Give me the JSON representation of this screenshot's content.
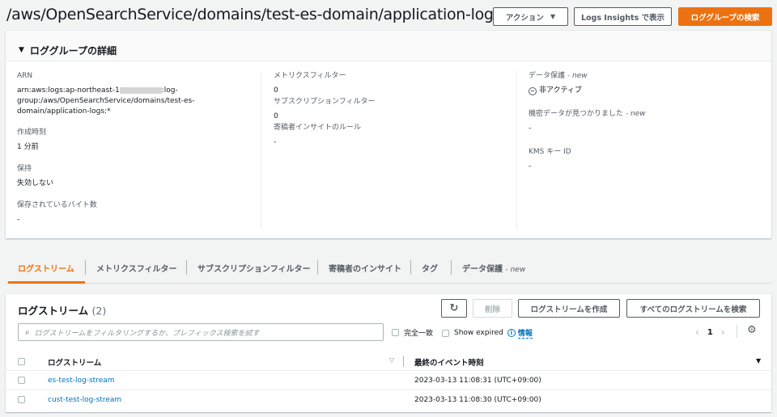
{
  "header": {
    "title": "/aws/OpenSearchService/domains/test-es-domain/application-logs",
    "actions_label": "アクション",
    "logs_insights_label": "Logs Insights で表示",
    "search_group_label": "ロググループの検索"
  },
  "details": {
    "heading": "ロググループの詳細",
    "arn_label": "ARN",
    "arn_value_prefix": "arn:aws:logs:ap-northeast-1",
    "arn_value_suffix": ":log-",
    "arn_value_line2": "group:/aws/OpenSearchService/domains/test-es-",
    "arn_value_line3": "domain/application-logs:*",
    "created_label": "作成時刻",
    "created_value": "1 分前",
    "retention_label": "保持",
    "retention_value": "失効しない",
    "stored_bytes_label": "保存されているバイト数",
    "stored_bytes_value": "-",
    "metric_filters_label": "メトリクスフィルター",
    "metric_filters_value": "0",
    "subscription_filters_label": "サブスクリプションフィルター",
    "subscription_filters_value": "0",
    "contributor_label": "寄稿者インサイトのルール",
    "contributor_value": "-",
    "data_protection_label": "データ保護",
    "data_protection_value": "非アクティブ",
    "sensitive_label": "機密データが見つかりました",
    "sensitive_value": "-",
    "kms_label": "KMS キー ID",
    "kms_value": "-",
    "new_tag": "- new"
  },
  "tabs": [
    {
      "label": "ログストリーム"
    },
    {
      "label": "メトリクスフィルター"
    },
    {
      "label": "サブスクリプションフィルター"
    },
    {
      "label": "寄稿者のインサイト"
    },
    {
      "label": "タグ"
    },
    {
      "label": "データ保護"
    }
  ],
  "streams": {
    "title": "ログストリーム",
    "count": "(2)",
    "delete_label": "削除",
    "create_label": "ログストリームを作成",
    "search_all_label": "すべてのログストリームを検索",
    "search_placeholder": "ログストリームをフィルタリングするか、プレフィックス検索を試す",
    "exact_match_label": "完全一致",
    "show_expired_label": "Show expired",
    "info_label": "情報",
    "page_number": "1",
    "col_stream": "ログストリーム",
    "col_last_event": "最終のイベント時刻",
    "rows": [
      {
        "name": "es-test-log-stream",
        "time": "2023-03-13 11:08:31 (UTC+09:00)"
      },
      {
        "name": "cust-test-log-stream",
        "time": "2023-03-13 11:08:30 (UTC+09:00)"
      }
    ]
  },
  "colors": {
    "accent": "#ec7211",
    "link": "#0073bb",
    "background": "#f2f3f3"
  }
}
